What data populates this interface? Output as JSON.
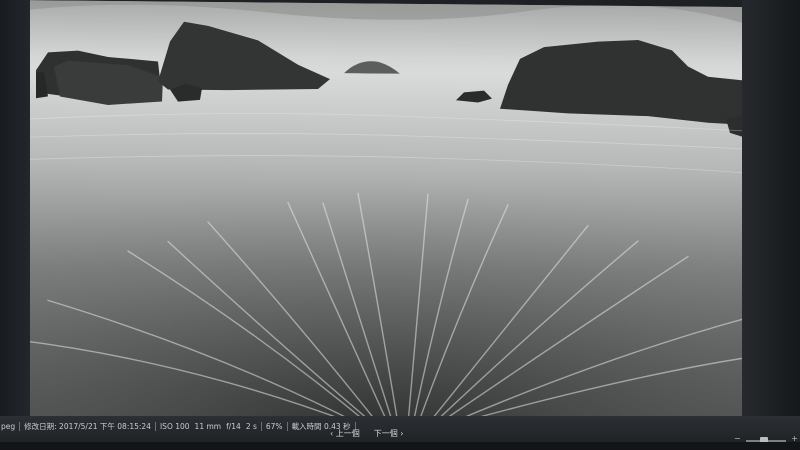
{
  "photo": {
    "subject": "long-exposure black and white seascape with rocks",
    "alt": "",
    "colors": {
      "sky": "#c9cbca",
      "sea": "#9a9c9b",
      "sand": "#4a4b4b",
      "rock": "#2b2c2d"
    }
  },
  "statusbar": {
    "file_type": "peg",
    "modified_date": "修改日期: 2017/5/21 下午 08:15:24",
    "iso": "ISO 100",
    "focal_length": "11 mm",
    "aperture": "f/14",
    "exposure": "2 s",
    "zoom": "67%",
    "load_time": "載入時間 0.43 秒",
    "prev_label": "‹ 上一個",
    "next_label": "下一個 ›",
    "zoom_minus": "−",
    "zoom_plus": "+",
    "zoom_slider_value": 0.45
  }
}
